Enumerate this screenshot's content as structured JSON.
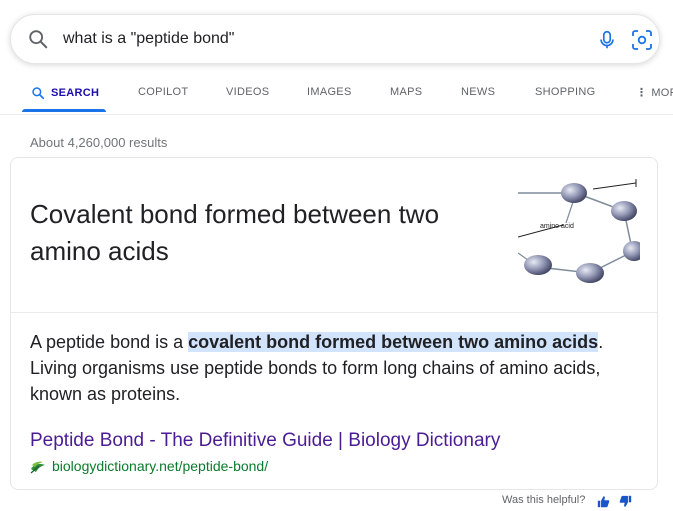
{
  "search": {
    "query": "what is a \"peptide bond\""
  },
  "tabs": [
    {
      "label": "SEARCH",
      "active": true
    },
    {
      "label": "COPILOT"
    },
    {
      "label": "VIDEOS"
    },
    {
      "label": "IMAGES"
    },
    {
      "label": "MAPS"
    },
    {
      "label": "NEWS"
    },
    {
      "label": "SHOPPING"
    },
    {
      "label": "MOR"
    }
  ],
  "stats": "About 4,260,000 results",
  "featured": {
    "answer": "Covalent bond formed between two amino acids",
    "image_label": "amino acid",
    "snippet_before": "A peptide bond is a ",
    "snippet_highlight": "covalent bond formed between two amino acids",
    "snippet_after": ". Living organisms use peptide bonds to form long chains of amino acids, known as proteins.",
    "result_title": "Peptide Bond - The Definitive Guide | Biology Dictionary",
    "result_url": "biologydictionary.net/peptide-bond/"
  },
  "feedback": {
    "label": "Was this helpful?"
  },
  "colors": {
    "accent": "#1a73e8",
    "link_visited": "#4b1c94",
    "url_green": "#0c7a2b",
    "highlight": "#d2e3fc"
  },
  "icons": [
    "search-icon",
    "mic-icon",
    "camera-lens-icon",
    "more-dots-icon",
    "favicon-icon",
    "thumbs-up-icon",
    "thumbs-down-icon"
  ]
}
